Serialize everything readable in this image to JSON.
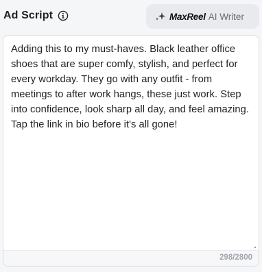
{
  "header": {
    "title": "Ad Script",
    "info_icon": "info-icon",
    "ai_button": {
      "icon": "sparkle-icon",
      "brand": "MaxReel",
      "label": "AI Writer"
    }
  },
  "editor": {
    "text": "Adding this to my must-haves. Black leather office shoes that are super comfy, stylish, and perfect for every workday. They go with any outfit - from meetings to after work hangs, these just work. Step into confidence, look sharp all day, and feel amazing. Tap the link in bio before it's all gone!",
    "char_count": "298/2800"
  }
}
